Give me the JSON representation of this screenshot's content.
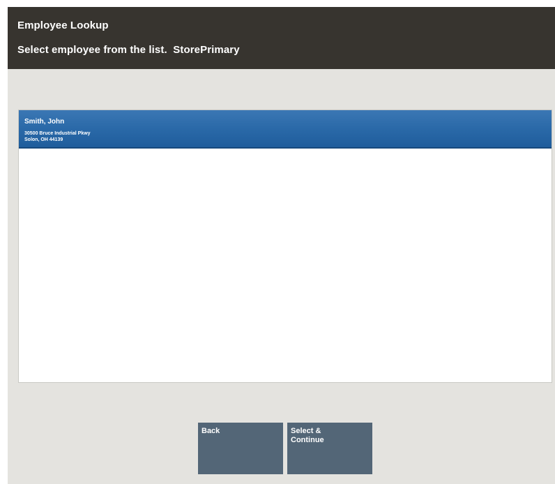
{
  "header": {
    "title": "Employee Lookup",
    "subtitle": "Select employee from the list.  StorePrimary"
  },
  "employee_list": {
    "items": [
      {
        "name": "Smith, John",
        "address_line1": "30500 Bruce Industrial Pkwy",
        "address_line2": "Solon, OH 44139",
        "selected": true
      }
    ]
  },
  "buttons": {
    "back_label": "Back",
    "select_label_line1": "Select &",
    "select_label_line2": "Continue"
  },
  "colors": {
    "header_bg": "#37342f",
    "frame_bg": "#e4e3df",
    "selected_row": "#2a69a8",
    "button_bg": "#536677"
  }
}
